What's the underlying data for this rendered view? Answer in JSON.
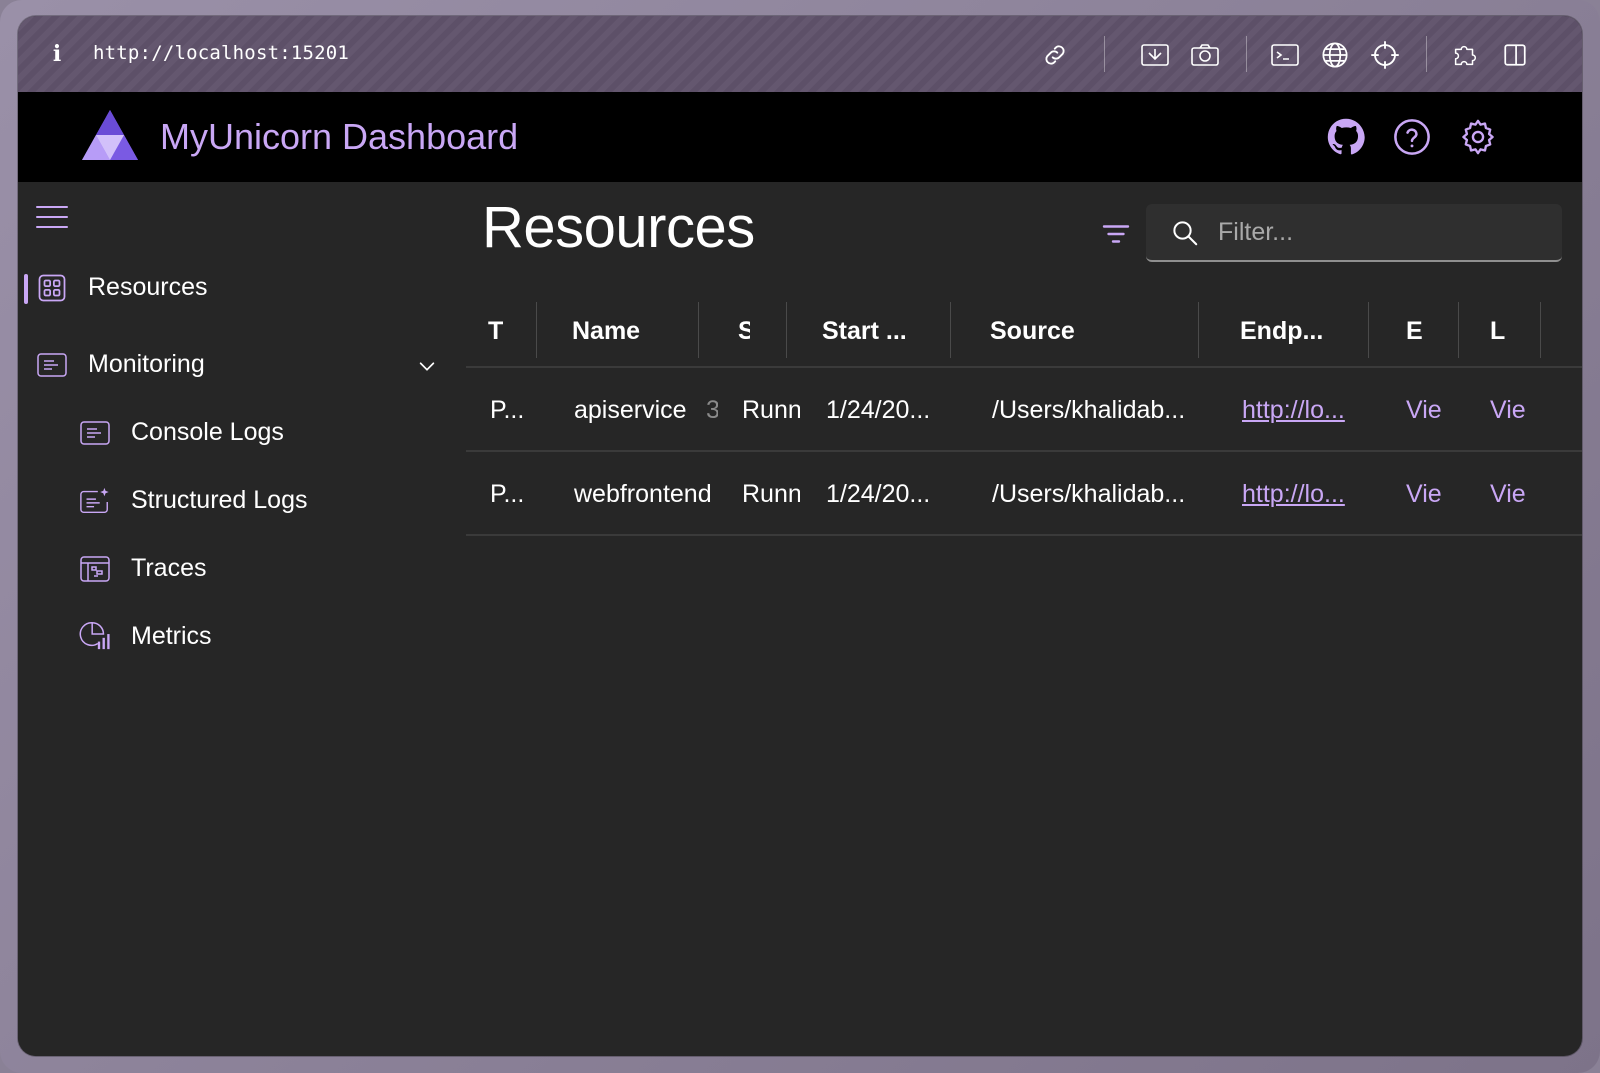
{
  "browser": {
    "url": "http://localhost:15201"
  },
  "app": {
    "title": "MyUnicorn Dashboard",
    "accent": "#c9a7f5"
  },
  "sidebar": {
    "items": [
      {
        "label": "Resources",
        "icon": "grid-icon",
        "active": true
      },
      {
        "label": "Monitoring",
        "icon": "log-icon",
        "expanded": true
      },
      {
        "label": "Console Logs",
        "icon": "console-log-icon"
      },
      {
        "label": "Structured Logs",
        "icon": "structured-log-icon"
      },
      {
        "label": "Traces",
        "icon": "traces-icon"
      },
      {
        "label": "Metrics",
        "icon": "metrics-icon"
      }
    ]
  },
  "main": {
    "title": "Resources",
    "search": {
      "placeholder": "Filter...",
      "value": ""
    },
    "columns": [
      "T",
      "Name",
      "S",
      "Start ...",
      "Source",
      "Endp...",
      "E",
      "L"
    ],
    "rows": [
      {
        "type": "P...",
        "name": "apiservice",
        "extra": "3",
        "state": "Runn",
        "start": "1/24/20...",
        "source": "/Users/khalidab...",
        "endpoint": "http://lo...",
        "env": "Vie",
        "logs": "Vie"
      },
      {
        "type": "P...",
        "name": "webfrontend",
        "extra": "",
        "state": "Runn",
        "start": "1/24/20...",
        "source": "/Users/khalidab...",
        "endpoint": "http://lo...",
        "env": "Vie",
        "logs": "Vie"
      }
    ]
  }
}
